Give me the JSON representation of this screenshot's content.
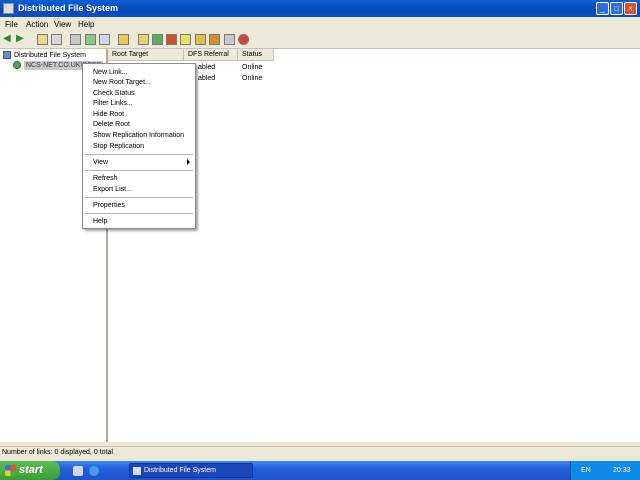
{
  "window": {
    "title": "Distributed File System"
  },
  "menu": [
    "File",
    "Action",
    "View",
    "Help"
  ],
  "tree": {
    "root": "Distributed File System",
    "child": "NCS-NET.CO.UK\\DFSR"
  },
  "list": {
    "columns": [
      "Root Target",
      "DFS Referral",
      "Status"
    ],
    "rows": [
      {
        "referral": "abled",
        "status": "Online"
      },
      {
        "referral": "abled",
        "status": "Online"
      }
    ]
  },
  "context_menu": {
    "items": [
      "New Link...",
      "New Root Target...",
      "Check Status",
      "Filter Links...",
      "Hide Root",
      "Delete Root",
      "Show Replication Information",
      "Stop Replication",
      "View",
      "Refresh",
      "Export List...",
      "Properties",
      "Help"
    ]
  },
  "status_bar": "Number of links: 0 displayed, 0 total",
  "taskbar": {
    "start": "start",
    "task": "Distributed File System",
    "lang": "EN",
    "clock": "20:33"
  }
}
